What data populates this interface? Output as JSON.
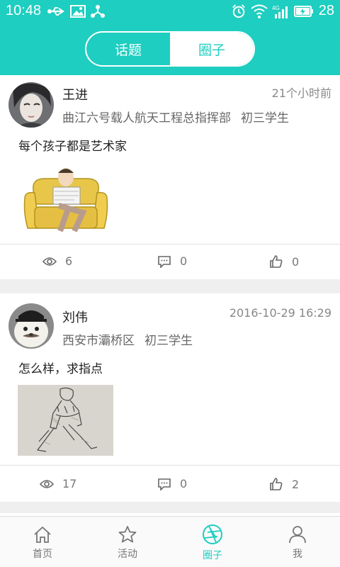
{
  "status": {
    "time": "10:48",
    "battery": "28",
    "network": "4G"
  },
  "segment": {
    "tabs": [
      "话题",
      "圈子"
    ],
    "active": 1
  },
  "posts": [
    {
      "name": "王进",
      "time": "21个小时前",
      "location": "曲江六号载人航天工程总指挥部",
      "grade": "初三学生",
      "content": "每个孩子都是艺术家",
      "views": "6",
      "comments": "0",
      "likes": "0"
    },
    {
      "name": "刘伟",
      "time": "2016-10-29 16:29",
      "location": "西安市灞桥区",
      "grade": "初三学生",
      "content": "怎么样，求指点",
      "views": "17",
      "comments": "0",
      "likes": "2"
    }
  ],
  "tabbar": {
    "items": [
      "首页",
      "活动",
      "圈子",
      "我"
    ],
    "active": 2
  },
  "colors": {
    "accent": "#1ecec0"
  }
}
